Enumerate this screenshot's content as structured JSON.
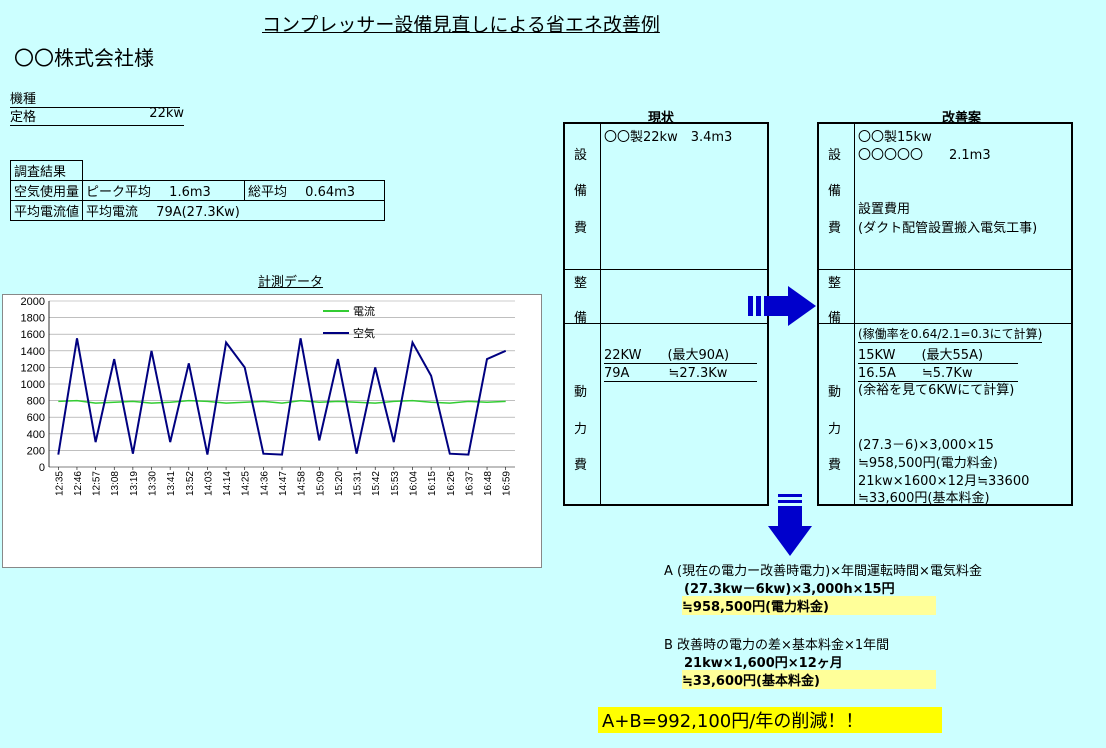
{
  "title": "コンプレッサー設備見直しによる省エネ改善例",
  "client": "〇〇株式会社様",
  "spec": {
    "kind_label": "機種",
    "rating_label": "定格",
    "rating_value": "22kw"
  },
  "survey": {
    "header": "調査結果",
    "air_label": "空気使用量",
    "peak_label": "ピーク平均",
    "peak_value": "1.6m3",
    "total_label": "総平均",
    "total_value": "0.64m3",
    "current_label": "平均電流値",
    "avg_current_label": "平均電流",
    "avg_current_value": "79A(27.3Kw)"
  },
  "chart_data": {
    "type": "line",
    "title": "計測データ",
    "ylim": [
      0,
      2000
    ],
    "yticks": [
      0,
      200,
      400,
      600,
      800,
      1000,
      1200,
      1400,
      1600,
      1800,
      2000
    ],
    "xtick_labels": [
      "12:35",
      "12:46",
      "12:57",
      "13:08",
      "13:19",
      "13:30",
      "13:41",
      "13:52",
      "14:03",
      "14:14",
      "14:25",
      "14:36",
      "14:47",
      "14:58",
      "15:09",
      "15:20",
      "15:31",
      "15:42",
      "15:53",
      "16:04",
      "16:15",
      "16:26",
      "16:37",
      "16:48",
      "16:59"
    ],
    "legend": "top-center",
    "grid": true,
    "series": [
      {
        "name": "電流",
        "color": "#33CC33",
        "values": [
          790,
          800,
          770,
          780,
          790,
          770,
          780,
          800,
          790,
          770,
          780,
          790,
          770,
          800,
          780,
          790,
          780,
          770,
          790,
          800,
          780,
          770,
          790,
          780,
          790
        ]
      },
      {
        "name": "空気",
        "color": "#000080",
        "values": [
          150,
          1550,
          300,
          1300,
          160,
          1400,
          300,
          1250,
          150,
          1500,
          1200,
          160,
          150,
          1550,
          320,
          1300,
          160,
          1200,
          300,
          1500,
          1100,
          160,
          150,
          1300,
          1400
        ]
      }
    ]
  },
  "current": {
    "heading": "現状",
    "cat_equipment": [
      "設",
      "備",
      "費"
    ],
    "cat_maint": [
      "整",
      "備"
    ],
    "cat_power": [
      "動",
      "力",
      "費"
    ],
    "eq_line1": "〇〇製22kw　3.4m3",
    "power_line1": "22KW　　(最大90A)",
    "power_line2": "79A　　　≒27.3Kw"
  },
  "proposal": {
    "heading": "改善案",
    "cat_equipment": [
      "設",
      "備",
      "費"
    ],
    "cat_maint": [
      "整",
      "備"
    ],
    "cat_power": [
      "動",
      "力",
      "費"
    ],
    "eq_line1": "〇〇製15kw",
    "eq_line2": "〇〇〇〇〇　　2.1m3",
    "eq_line3": "設置費用",
    "eq_line4": "(ダクト配管設置搬入電気工事)",
    "power_line1": "(稼働率を0.64/2.1=0.3にて計算)",
    "power_line2": "15KW　　(最大55A)",
    "power_line3": "16.5A　　≒5.7Kw",
    "power_line4": "(余裕を見て6KWにて計算)",
    "power_line5": "(27.3－6)×3,000×15",
    "power_line6": "≒958,500円(電力料金)",
    "power_line7": "21kw×1600×12月≒33600",
    "power_line8": "≒33,600円(基本料金)"
  },
  "summary": {
    "a_line1": "A (現在の電力ー改善時電力)×年間運転時間×電気料金",
    "a_line2": "(27.3kw－6kw)×3,000h×15円",
    "a_line3": "≒958,500円(電力料金)",
    "b_line1": "B 改善時の電力の差×基本料金×1年間",
    "b_line2": "21kw×1,600円×12ヶ月",
    "b_line3": "≒33,600円(基本料金)",
    "total": "A+B=992,100円/年の削減！！"
  },
  "colors": {
    "background": "#CCFFFF",
    "arrow": "#0000CC",
    "highlight": "#FFFF99",
    "total_highlight": "#FFFF00"
  }
}
